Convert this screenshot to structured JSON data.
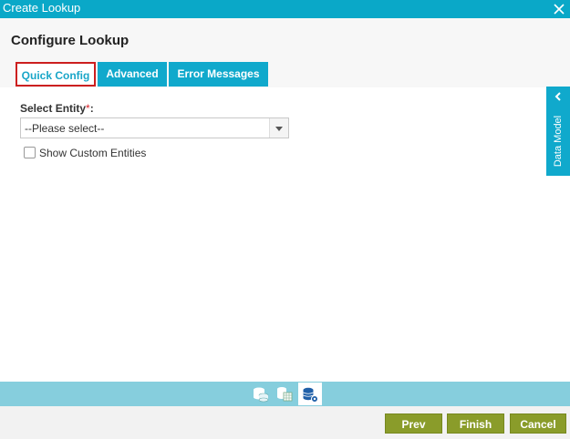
{
  "window": {
    "title": "Create Lookup",
    "close_icon": "close-icon"
  },
  "page": {
    "title": "Configure Lookup"
  },
  "tabs": [
    {
      "label": "Quick Config",
      "active": true
    },
    {
      "label": "Advanced",
      "active": false
    },
    {
      "label": "Error Messages",
      "active": false
    }
  ],
  "form": {
    "entity_label": "Select Entity",
    "required_marker": "*",
    "label_suffix": ":",
    "entity_value": "--Please select--",
    "custom_entities_label": "Show Custom Entities",
    "custom_entities_checked": false
  },
  "side_panel": {
    "label": "Data Model",
    "icon": "chevron-left-icon"
  },
  "bottom_icons": [
    "database-icon",
    "database-table-icon",
    "database-settings-icon"
  ],
  "buttons": {
    "prev": "Prev",
    "finish": "Finish",
    "cancel": "Cancel"
  },
  "colors": {
    "accent": "#10a9cc",
    "button": "#8a9c2a",
    "active_tab_border": "#cc1f1f"
  }
}
